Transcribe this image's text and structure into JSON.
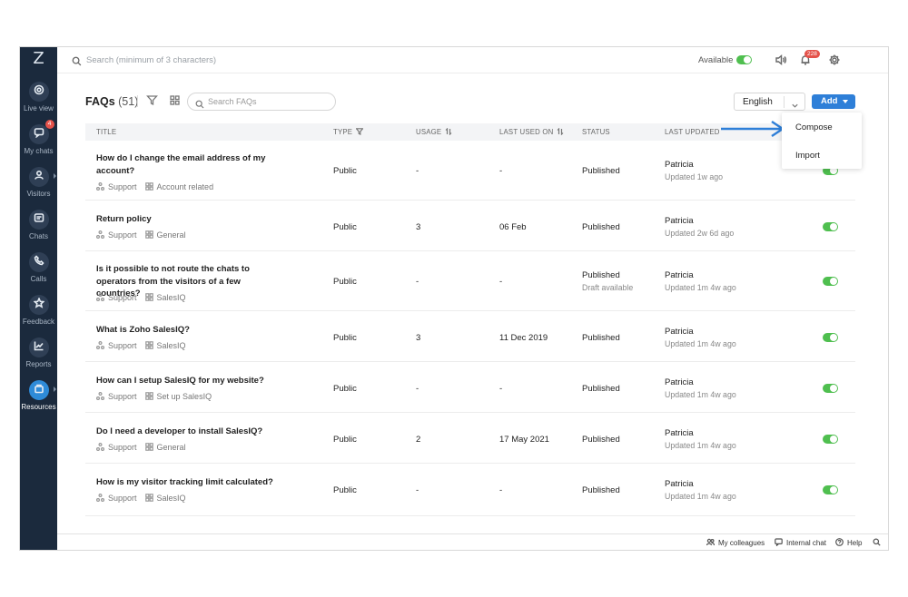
{
  "sidebar": {
    "logo": "Z",
    "items": [
      {
        "label": "Live view",
        "icon": "live-view-icon"
      },
      {
        "label": "My chats",
        "icon": "chat-bubble-icon",
        "badge": "4"
      },
      {
        "label": "Visitors",
        "icon": "visitor-icon"
      },
      {
        "label": "Chats",
        "icon": "chats-icon"
      },
      {
        "label": "Calls",
        "icon": "phone-icon"
      },
      {
        "label": "Feedback",
        "icon": "star-icon"
      },
      {
        "label": "Reports",
        "icon": "reports-icon"
      },
      {
        "label": "Resources",
        "icon": "resources-icon",
        "active": true
      }
    ]
  },
  "topbar": {
    "search_placeholder": "Search (minimum of 3 characters)",
    "availability_label": "Available",
    "availability_on": true,
    "notification_count": "228"
  },
  "header": {
    "title": "FAQs",
    "count": "(51)",
    "search_placeholder": "Search FAQs",
    "language": "English",
    "add_label": "Add"
  },
  "menu": {
    "items": [
      "Compose",
      "Import"
    ]
  },
  "table": {
    "columns": [
      "TITLE",
      "TYPE",
      "USAGE",
      "LAST USED ON",
      "STATUS",
      "LAST UPDATED"
    ],
    "rows": [
      {
        "title": "How do I change the email address of my account?",
        "dept": "Support",
        "category": "Account related",
        "type": "Public",
        "usage": "-",
        "last_used": "-",
        "status": "Published",
        "status_sub": "",
        "updated_by": "Patricia",
        "updated_ago": "Updated 1w ago",
        "enabled": true
      },
      {
        "title": "Return policy",
        "dept": "Support",
        "category": "General",
        "type": "Public",
        "usage": "3",
        "last_used": "06 Feb",
        "status": "Published",
        "status_sub": "",
        "updated_by": "Patricia",
        "updated_ago": "Updated 2w 6d ago",
        "enabled": true
      },
      {
        "title": "Is it possible to not route the chats to operators from the visitors of a few countries?",
        "dept": "Support",
        "category": "SalesIQ",
        "type": "Public",
        "usage": "-",
        "last_used": "-",
        "status": "Published",
        "status_sub": "Draft available",
        "updated_by": "Patricia",
        "updated_ago": "Updated 1m 4w ago",
        "enabled": true
      },
      {
        "title": "What is Zoho SalesIQ?",
        "dept": "Support",
        "category": "SalesIQ",
        "type": "Public",
        "usage": "3",
        "last_used": "11 Dec 2019",
        "status": "Published",
        "status_sub": "",
        "updated_by": "Patricia",
        "updated_ago": "Updated 1m 4w ago",
        "enabled": true
      },
      {
        "title": "How can I setup SalesIQ for my website?",
        "dept": "Support",
        "category": "Set up SalesIQ",
        "type": "Public",
        "usage": "-",
        "last_used": "-",
        "status": "Published",
        "status_sub": "",
        "updated_by": "Patricia",
        "updated_ago": "Updated 1m 4w ago",
        "enabled": true
      },
      {
        "title": "Do I need a developer to install SalesIQ?",
        "dept": "Support",
        "category": "General",
        "type": "Public",
        "usage": "2",
        "last_used": "17 May 2021",
        "status": "Published",
        "status_sub": "",
        "updated_by": "Patricia",
        "updated_ago": "Updated 1m 4w ago",
        "enabled": true
      },
      {
        "title": "How is my visitor tracking limit calculated?",
        "dept": "Support",
        "category": "SalesIQ",
        "type": "Public",
        "usage": "-",
        "last_used": "-",
        "status": "Published",
        "status_sub": "",
        "updated_by": "Patricia",
        "updated_ago": "Updated 1m 4w ago",
        "enabled": true
      }
    ]
  },
  "footer": {
    "colleagues": "My colleagues",
    "internal_chat": "Internal chat",
    "help": "Help"
  },
  "colors": {
    "sidebar_bg": "#1b2a3d",
    "accent": "#2e7fd8",
    "toggle_on": "#4fbf4f",
    "badge": "#e4524a"
  }
}
